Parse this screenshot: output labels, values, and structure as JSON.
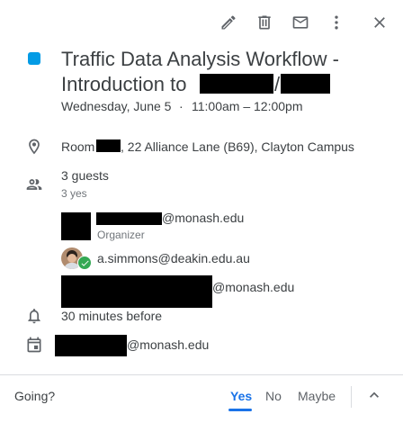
{
  "toolbar": {
    "edit_icon": "pencil-icon",
    "delete_icon": "trash-icon",
    "email_icon": "mail-icon",
    "more_icon": "more-vert-icon",
    "close_icon": "close-icon"
  },
  "event": {
    "color": "#039be5",
    "title_line1": "Traffic Data Analysis Workflow -",
    "title_line2_prefix": "Introduction to",
    "title_slash": "/",
    "date": "Wednesday, June 5",
    "separator": "·",
    "time": "11:00am – 12:00pm",
    "location_prefix": "Room",
    "location_suffix": ", 22 Alliance Lane (B69), Clayton Campus"
  },
  "guests": {
    "summary": "3 guests",
    "yes_count": "3 yes",
    "list": [
      {
        "email_suffix": "@monash.edu",
        "role": "Organizer"
      },
      {
        "email": "a.simmons@deakin.edu.au"
      },
      {
        "email_suffix": "@monash.edu"
      }
    ]
  },
  "reminder": "30 minutes before",
  "calendar_owner_suffix": "@monash.edu",
  "footer": {
    "going_label": "Going?",
    "yes": "Yes",
    "no": "No",
    "maybe": "Maybe",
    "expand_icon": "chevron-up-icon"
  },
  "colors": {
    "accent": "#1a73e8",
    "text": "#3c4043",
    "secondary": "#70757a"
  }
}
